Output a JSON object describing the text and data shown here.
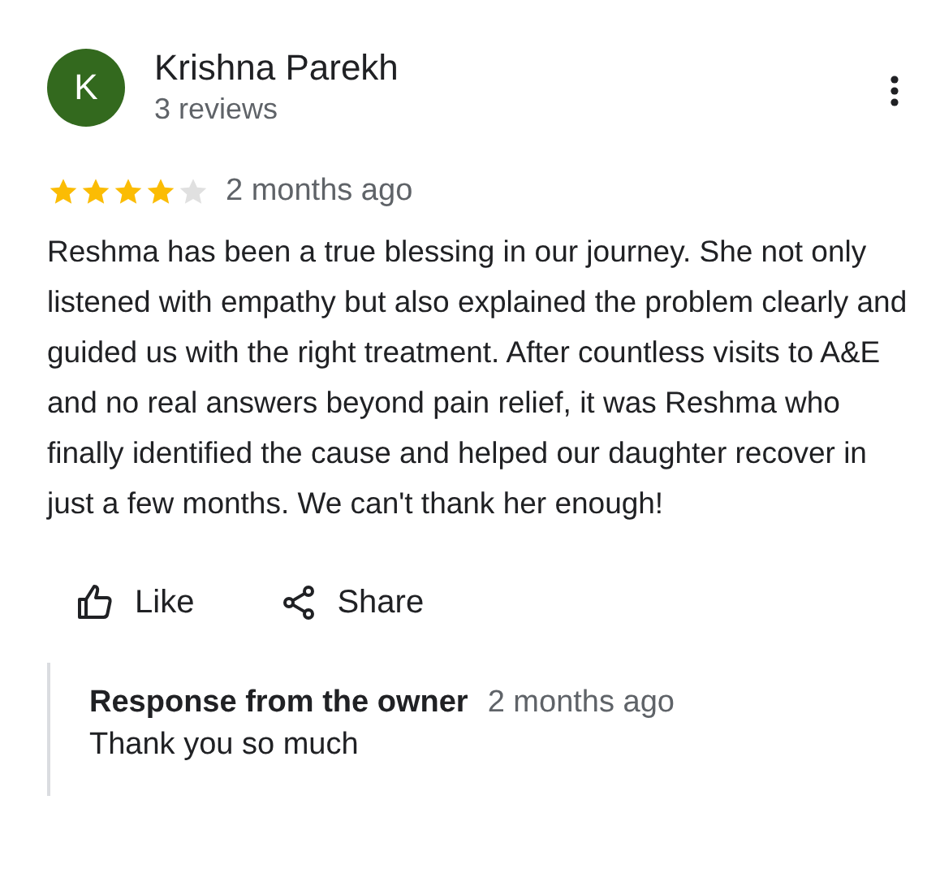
{
  "reviewer": {
    "initial": "K",
    "name": "Krishna Parekh",
    "reviews": "3 reviews"
  },
  "review": {
    "stars": 4,
    "time": "2 months ago",
    "text": "Reshma has been a true blessing in our journey. She not only listened with empathy but also explained the problem clearly and guided us with the right treatment. After countless visits to A&E and no real answers beyond pain relief, it was Reshma who finally identified the cause and helped our daughter recover in just a few months. We can't thank her enough!"
  },
  "actions": [
    {
      "kind": "like",
      "label": "Like"
    },
    {
      "kind": "share",
      "label": "Share"
    }
  ],
  "response": {
    "title": "Response from the owner",
    "time": "2 months ago",
    "text": "Thank you so much"
  }
}
